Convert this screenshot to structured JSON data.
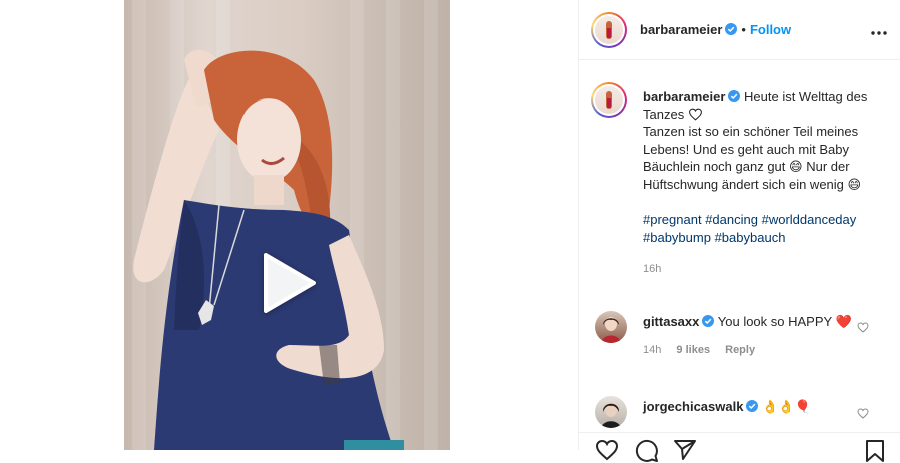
{
  "post": {
    "username": "barbarameier",
    "follow_label": "Follow",
    "separator": "•"
  },
  "caption": {
    "username": "barbarameier",
    "line1": "Heute ist Welttag des Tanzes",
    "line2_a": "Tanzen ist so ein schöner Teil meines Lebens! Und es geht auch mit Baby Bäuchlein noch ganz gut",
    "emoji1": "😄",
    "line2_b": "Nur der Hüftschwung ändert sich ein wenig",
    "emoji2": "😄",
    "hashtags": [
      "#pregnant",
      "#dancing",
      "#worlddanceday",
      "#babybump",
      "#babybauch"
    ],
    "time": "16h"
  },
  "comments": [
    {
      "username": "gittasaxx",
      "text": "You look so HAPPY",
      "emoji": "❤️",
      "time": "14h",
      "likes": "9 likes",
      "reply_label": "Reply"
    },
    {
      "username": "jorgechicaswalk",
      "emoji": "👌👌🎈"
    }
  ],
  "colors": {
    "link_blue": "#0095f6",
    "hashtag": "#00376b",
    "muted": "#8e8e8e",
    "dress": "#2c3a73",
    "hair": "#c9643a"
  },
  "icons": [
    "play-icon",
    "verified-icon",
    "more-icon",
    "heart-icon",
    "comment-icon",
    "share-icon",
    "bookmark-icon"
  ]
}
